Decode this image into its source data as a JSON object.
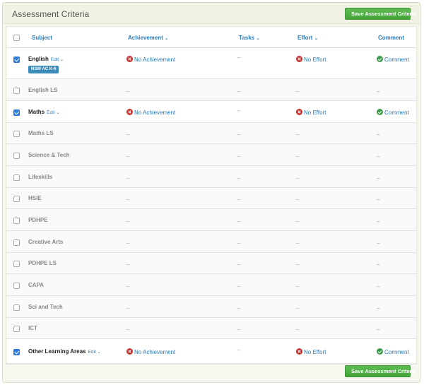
{
  "panel": {
    "title": "Assessment Criteria",
    "save_label": "Save Assessment Criteria"
  },
  "columns": {
    "subject": "Subject",
    "achievement": "Achievement",
    "tasks": "Tasks",
    "effort": "Effort",
    "comment": "Comment"
  },
  "icons": {
    "caret": "chevron-down-icon",
    "no_achievement": "x-circle-icon",
    "no_effort": "x-circle-icon",
    "comment": "check-circle-icon"
  },
  "colors": {
    "accent": "#2a7ab8",
    "save_button": "#4cae42",
    "error_icon": "#c9302c",
    "ok_icon": "#3c9a4a",
    "tag": "#3b8cb9"
  },
  "rows": [
    {
      "subject": "English",
      "checked": true,
      "edit": "Edit",
      "tag": "NSW AC K-6",
      "achievement": "No Achievement",
      "tasks": "–",
      "effort": "No Effort",
      "comment": "Comment"
    },
    {
      "subject": "English LS",
      "checked": false,
      "achievement": "–",
      "tasks": "–",
      "effort": "–",
      "comment": "–"
    },
    {
      "subject": "Maths",
      "checked": true,
      "edit": "Edit",
      "achievement": "No Achievement",
      "tasks": "–",
      "effort": "No Effort",
      "comment": "Comment"
    },
    {
      "subject": "Maths LS",
      "checked": false,
      "achievement": "–",
      "tasks": "–",
      "effort": "–",
      "comment": "–"
    },
    {
      "subject": "Science & Tech",
      "checked": false,
      "achievement": "–",
      "tasks": "–",
      "effort": "–",
      "comment": "–"
    },
    {
      "subject": "Lifeskills",
      "checked": false,
      "achievement": "–",
      "tasks": "–",
      "effort": "–",
      "comment": "–"
    },
    {
      "subject": "HSIE",
      "checked": false,
      "achievement": "–",
      "tasks": "–",
      "effort": "–",
      "comment": "–"
    },
    {
      "subject": "PDHPE",
      "checked": false,
      "achievement": "–",
      "tasks": "–",
      "effort": "–",
      "comment": "–"
    },
    {
      "subject": "Creative Arts",
      "checked": false,
      "achievement": "–",
      "tasks": "–",
      "effort": "–",
      "comment": "–"
    },
    {
      "subject": "PDHPE LS",
      "checked": false,
      "achievement": "–",
      "tasks": "–",
      "effort": "–",
      "comment": "–"
    },
    {
      "subject": "CAPA",
      "checked": false,
      "achievement": "–",
      "tasks": "–",
      "effort": "–",
      "comment": "–"
    },
    {
      "subject": "Sci and Tech",
      "checked": false,
      "achievement": "–",
      "tasks": "–",
      "effort": "–",
      "comment": "–"
    },
    {
      "subject": "ICT",
      "checked": false,
      "achievement": "–",
      "tasks": "–",
      "effort": "–",
      "comment": "–"
    },
    {
      "subject": "Other Learning Areas",
      "checked": true,
      "edit": "Edit",
      "achievement": "No Achievement",
      "tasks": "–",
      "effort": "No Effort",
      "comment": "Comment"
    }
  ]
}
